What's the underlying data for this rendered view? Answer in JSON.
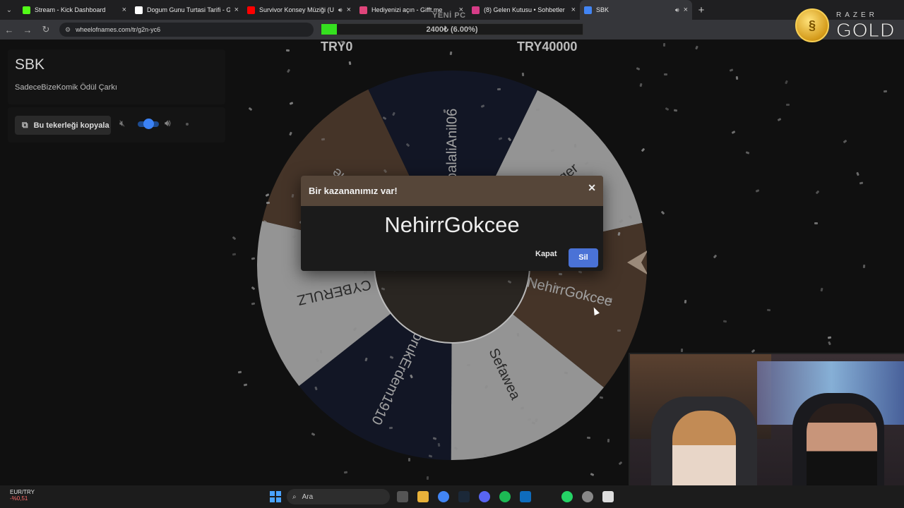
{
  "browser": {
    "tabs": [
      {
        "label": "Stream - Kick Dashboard",
        "color": "#53fc18",
        "active": false,
        "audio": false
      },
      {
        "label": "Dogum Gunu Turtasi Tarifi - Git",
        "color": "#ffffff",
        "active": false,
        "audio": false
      },
      {
        "label": "Survivor Konsey Müziği (U",
        "color": "#ff0000",
        "active": false,
        "audio": true
      },
      {
        "label": "Hediyenizi açın - Gifft.me",
        "color": "#e0457b",
        "active": false,
        "audio": false
      },
      {
        "label": "(8) Gelen Kutusu • Sohbetler",
        "color": "#d63c87",
        "active": false,
        "audio": false
      },
      {
        "label": "SBK",
        "color": "#4285f4",
        "active": true,
        "audio": true
      }
    ],
    "url": "wheelofnames.com/tr/g2n-yc6"
  },
  "overlay": {
    "goal_label": "YENİ PC",
    "goal_text": "2400₺ (6.00%)",
    "goal_progress": 0.06,
    "try_left": "TRY0",
    "try_right": "TRY40000",
    "razer_brand": "RAZER",
    "razer_gold": "GOLD"
  },
  "sidebar": {
    "title": "SBK",
    "subtitle": "SadeceBizeKomik Ödül Çarkı",
    "copy_button": "Bu tekerleği kopyala"
  },
  "wheel": {
    "segments": [
      {
        "name": "Kaybedeger",
        "color": "#c9c9c9"
      },
      {
        "name": "NehirrGokcee",
        "color": "#5b4433"
      },
      {
        "name": "Sefawea",
        "color": "#c9c9c9"
      },
      {
        "name": "DorukErdem1910",
        "color": "#141a2e"
      },
      {
        "name": "CYBERULZ",
        "color": "#c9c9c9"
      },
      {
        "name": "egeonline",
        "color": "#5b4433"
      },
      {
        "name": "balaliAnil06",
        "color": "#141a2e"
      }
    ]
  },
  "modal": {
    "title": "Bir kazananımız var!",
    "winner": "NehirrGokcee",
    "close_label": "Kapat",
    "delete_label": "Sil"
  },
  "taskbar": {
    "currency": "EUR/TRY",
    "change": "-%0,51",
    "search_placeholder": "Ara"
  }
}
